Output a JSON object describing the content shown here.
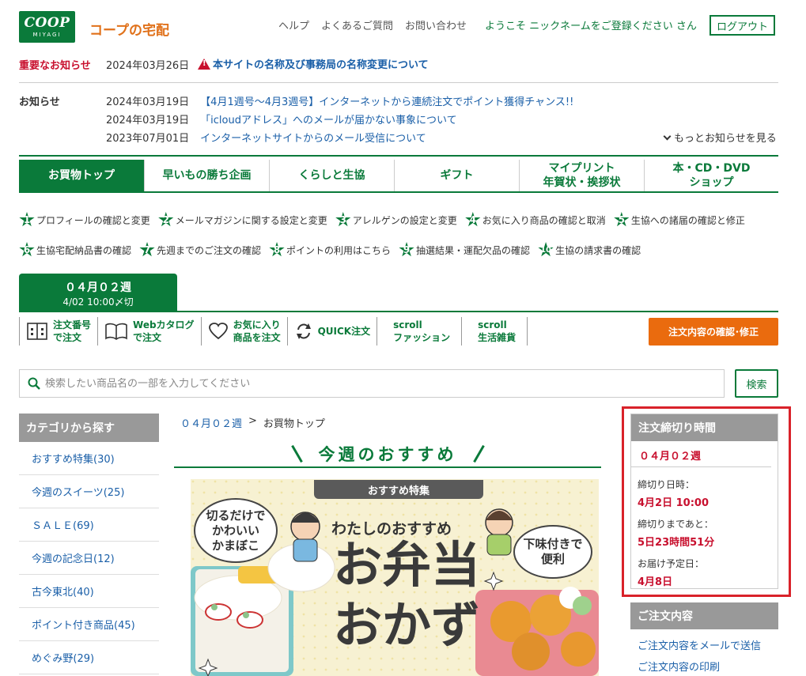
{
  "header": {
    "logo_main": "COOP",
    "logo_sub": "MIYAGI",
    "site_name": "コープの宅配",
    "links": [
      "ヘルプ",
      "よくあるご質問",
      "お問い合わせ"
    ],
    "welcome": "ようこそ ニックネームをご登録ください さん",
    "logout": "ログアウト"
  },
  "important_notice": {
    "label": "重要なお知らせ",
    "date": "2024年03月26日",
    "text": "本サイトの名称及び事務局の名称変更について"
  },
  "notices": {
    "label": "お知らせ",
    "items": [
      {
        "date": "2024年03月19日",
        "text": "【4月1週号～4月3週号】インターネットから連続注文でポイント獲得チャンス!!"
      },
      {
        "date": "2024年03月19日",
        "text": "「icloudアドレス」へのメールが届かない事象について"
      },
      {
        "date": "2023年07月01日",
        "text": "インターネットサイトからのメール受信について"
      }
    ],
    "more": "もっとお知らせを見る"
  },
  "main_nav": [
    {
      "line1": "お買物トップ",
      "line2": ""
    },
    {
      "line1": "早いもの勝ち企画",
      "line2": ""
    },
    {
      "line1": "くらしと生協",
      "line2": ""
    },
    {
      "line1": "ギフト",
      "line2": ""
    },
    {
      "line1": "マイプリント",
      "line2": "年賀状・挨拶状"
    },
    {
      "line1": "本・CD・DVD",
      "line2": "ショップ"
    }
  ],
  "steps_row1": [
    {
      "num": "1",
      "label": "プロフィールの確認と変更"
    },
    {
      "num": "2",
      "label": "メールマガジンに関する設定と変更"
    },
    {
      "num": "3",
      "label": "アレルゲンの設定と変更"
    },
    {
      "num": "4",
      "label": "お気に入り商品の確認と取消"
    },
    {
      "num": "5",
      "label": "生協への諸届の確認と修正"
    }
  ],
  "steps_row2": [
    {
      "num": "6",
      "label": "生協宅配納品書の確認"
    },
    {
      "num": "7",
      "label": "先週までのご注文の確認"
    },
    {
      "num": "8",
      "label": "ポイントの利用はこちら"
    },
    {
      "num": "9",
      "label": "抽選結果・運配欠品の確認"
    },
    {
      "num": "10",
      "label": "生協の請求書の確認"
    }
  ],
  "week_tab": {
    "week": "０４月０２週",
    "deadline": "4/02 10:00〆切"
  },
  "sub_nav": [
    {
      "line1": "注文番号",
      "line2": "で注文",
      "icon": "order-number-icon"
    },
    {
      "line1": "Webカタログ",
      "line2": "で注文",
      "icon": "catalog-book-icon"
    },
    {
      "line1": "お気に入り",
      "line2": "商品を注文",
      "icon": "heart-icon"
    },
    {
      "line1": "QUICK注文",
      "line2": "",
      "icon": "refresh-icon"
    },
    {
      "line1": "scroll",
      "line2": "ファッション",
      "icon": ""
    },
    {
      "line1": "scroll",
      "line2": "生活雑貨",
      "icon": ""
    }
  ],
  "confirm_button": "注文内容の確認･修正",
  "search": {
    "placeholder": "検索したい商品名の一部を入力してください",
    "value": "",
    "button": "検索"
  },
  "sidebar": {
    "title": "カテゴリから探す",
    "items": [
      "おすすめ特集(30)",
      "今週のスイーツ(25)",
      "ＳＡＬＥ(69)",
      "今週の記念日(12)",
      "古今東北(40)",
      "ポイント付き商品(45)",
      "めぐみ野(29)"
    ]
  },
  "breadcrumb": {
    "link": "０４月０２週",
    "sep": ">",
    "current": "お買物トップ"
  },
  "recommend": {
    "heading": "今週のおすすめ",
    "tag": "おすすめ特集",
    "bubble_left": "切るだけで\nかわいい\nかまぼこ",
    "bubble_right": "下味付きで\n便利",
    "subtitle": "わたしのおすすめ",
    "title1": "お弁当",
    "title2": "おかず"
  },
  "deadline_panel": {
    "title": "注文締切り時間",
    "week": "０４月０２週",
    "deadline_label": "締切り日時：",
    "deadline_value": "4月2日 10:00",
    "remaining_label": "締切りまであと：",
    "remaining_value": "5日23時間51分",
    "delivery_label": "お届け予定日：",
    "delivery_value": "4月8日"
  },
  "order_panel": {
    "title": "ご注文内容",
    "links": [
      "ご注文内容をメールで送信",
      "ご注文内容の印刷"
    ]
  },
  "colors": {
    "brand_green": "#0a7a3a",
    "accent_orange": "#ea6b0e",
    "alert_red": "#c8102e",
    "link_blue": "#1a5fa8"
  }
}
